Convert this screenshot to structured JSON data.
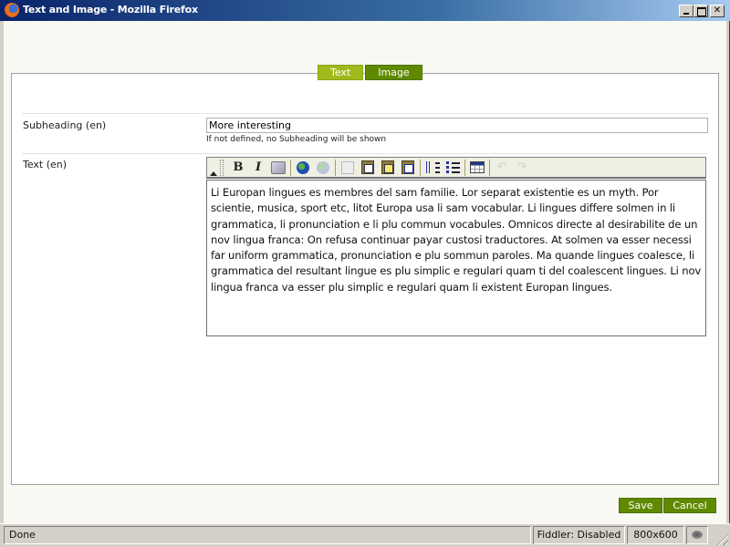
{
  "window": {
    "title": "Text and Image - Mozilla Firefox",
    "controls": {
      "minimize": "minimize",
      "maximize": "maximize",
      "close": "close"
    }
  },
  "tabs": [
    {
      "label": "Text",
      "active": false
    },
    {
      "label": "Image",
      "active": true
    }
  ],
  "form": {
    "subheading": {
      "label": "Subheading (en)",
      "value": "More interesting",
      "hint": "If not defined, no Subheading will be shown"
    },
    "text": {
      "label": "Text (en)",
      "toolbar": [
        "collapse-toolbar",
        "bold",
        "italic",
        "clean-up-messy-code",
        "insert-link",
        "unlink",
        "copy",
        "paste",
        "paste-as-text",
        "paste-from-word",
        "ordered-list",
        "unordered-list",
        "insert-table",
        "undo",
        "redo"
      ],
      "content": "Li Europan lingues es membres del sam familie. Lor separat existentie es un myth. Por scientie, musica, sport etc, litot Europa usa li sam vocabular. Li lingues differe solmen in li grammatica, li pronunciation e li plu commun vocabules. Omnicos directe al desirabilite de un nov lingua franca: On refusa continuar payar custosi traductores. At solmen va esser necessi far uniform grammatica, pronunciation e plu sommun paroles. Ma quande lingues coalesce, li grammatica del resultant lingue es plu simplic e regulari quam ti del coalescent lingues. Li nov lingua franca va esser plu simplic e regulari quam li existent Europan lingues."
    }
  },
  "actions": {
    "save": "Save",
    "cancel": "Cancel"
  },
  "statusbar": {
    "status": "Done",
    "fiddler": "Fiddler: Disabled",
    "resolution": "800x600"
  },
  "colors": {
    "accent_green": "#5f8a00",
    "tab_inactive": "#9fba1b"
  }
}
